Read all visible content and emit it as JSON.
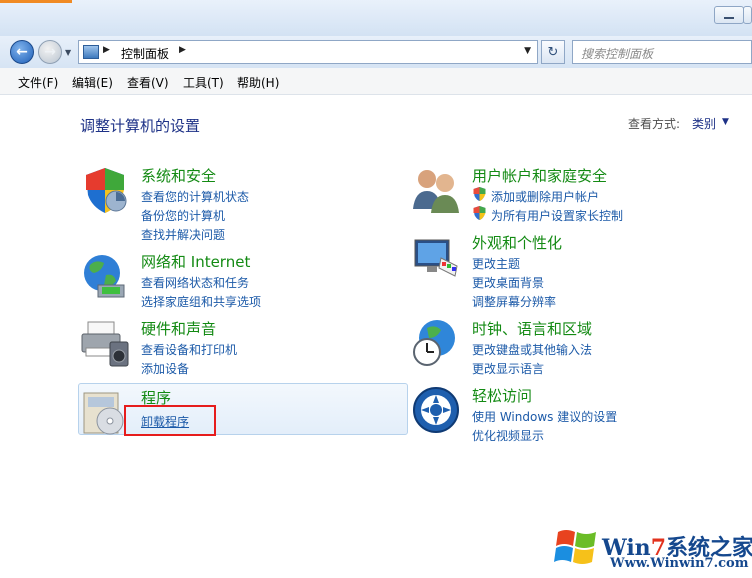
{
  "address": {
    "breadcrumb": "控制面板",
    "search_placeholder": "搜索控制面板"
  },
  "menu": [
    "文件(F)",
    "编辑(E)",
    "查看(V)",
    "工具(T)",
    "帮助(H)"
  ],
  "page": {
    "title": "调整计算机的设置",
    "view_by_label": "查看方式:",
    "view_by_value": "类别"
  },
  "categories": [
    {
      "title": "系统和安全",
      "links": [
        "查看您的计算机状态",
        "备份您的计算机",
        "查找并解决问题"
      ]
    },
    {
      "title": "网络和 Internet",
      "links": [
        "查看网络状态和任务",
        "选择家庭组和共享选项"
      ]
    },
    {
      "title": "硬件和声音",
      "links": [
        "查看设备和打印机",
        "添加设备"
      ]
    },
    {
      "title": "程序",
      "links": [
        "卸载程序"
      ]
    },
    {
      "title": "用户帐户和家庭安全",
      "links": [
        "添加或删除用户帐户",
        "为所有用户设置家长控制"
      ]
    },
    {
      "title": "外观和个性化",
      "links": [
        "更改主题",
        "更改桌面背景",
        "调整屏幕分辨率"
      ]
    },
    {
      "title": "时钟、语言和区域",
      "links": [
        "更改键盘或其他输入法",
        "更改显示语言"
      ]
    },
    {
      "title": "轻松访问",
      "links": [
        "使用 Windows 建议的设置",
        "优化视频显示"
      ]
    }
  ],
  "watermark": {
    "brand_prefix": "Win",
    "brand_seven": "7",
    "brand_suffix": "系统之家",
    "url": "Www.Winwin7.com"
  },
  "colors": {
    "link": "#1c5aa8",
    "category_title": "#138a13",
    "highlight_box": "#e61c1c"
  }
}
